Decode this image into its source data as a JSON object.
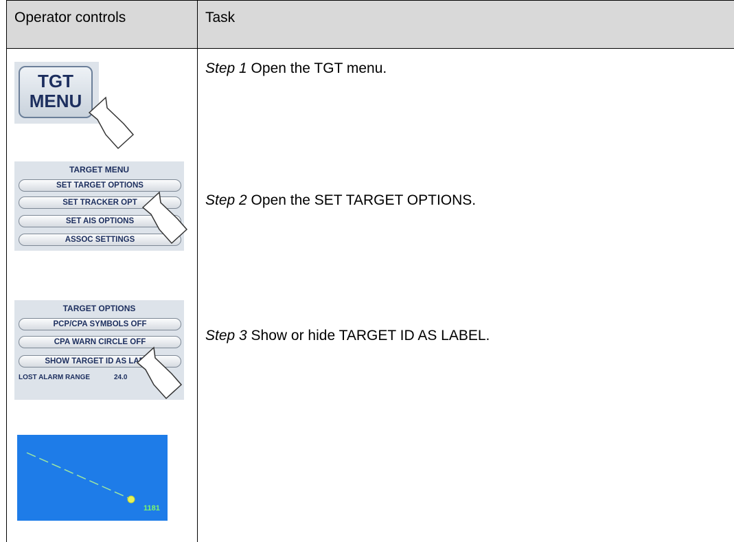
{
  "header": {
    "col1": "Operator controls",
    "col2": "Task"
  },
  "tgt_button": {
    "line1": "TGT",
    "line2": "MENU"
  },
  "target_menu": {
    "title": "TARGET MENU",
    "items": [
      "SET TARGET OPTIONS",
      "SET TRACKER OPT",
      "SET AIS OPTIONS",
      "ASSOC SETTINGS"
    ]
  },
  "target_options": {
    "title": "TARGET OPTIONS",
    "items": [
      "PCP/CPA SYMBOLS OFF",
      "CPA WARN CIRCLE OFF",
      "SHOW TARGET ID AS LABEL"
    ],
    "lost_alarm_label": "LOST ALARM RANGE",
    "lost_alarm_value": "24.0"
  },
  "radar": {
    "target_id": "1181"
  },
  "steps": [
    {
      "label": "Step 1",
      "text": " Open the TGT menu."
    },
    {
      "label": "Step 2",
      "text": " Open the SET TARGET OPTIONS."
    },
    {
      "label": "Step 3",
      "text": " Show or hide TARGET ID AS LABEL."
    }
  ],
  "colors": {
    "header_bg": "#d9d9d9",
    "radar_bg": "#1e7ce8",
    "target_label": "#7cf56c",
    "menu_text": "#1c2e5e"
  }
}
